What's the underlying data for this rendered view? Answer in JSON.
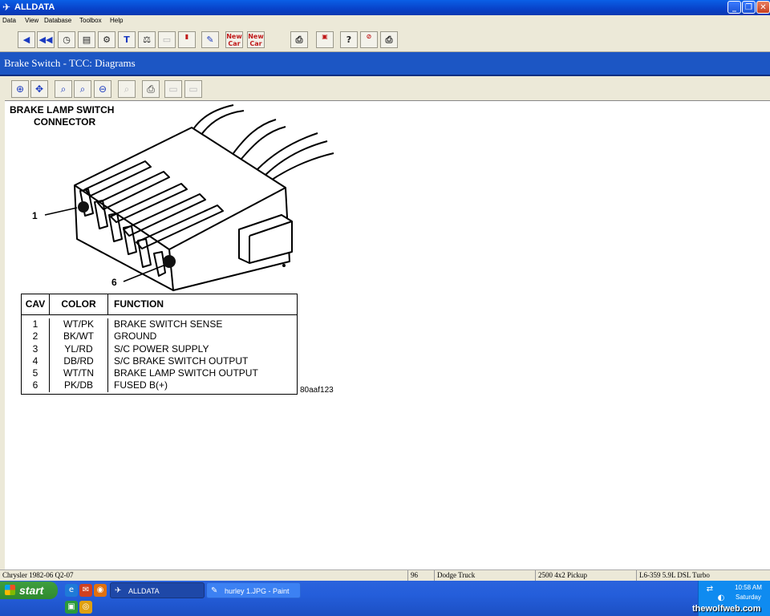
{
  "window": {
    "title": "ALLDATA",
    "controls": [
      "minimize",
      "restore",
      "close"
    ]
  },
  "menu": [
    "Data",
    "View",
    "Database",
    "Toolbox",
    "Help"
  ],
  "toolbar": {
    "new_car_label": "New Car",
    "new_car2_label": "New Car"
  },
  "document": {
    "header": "Brake Switch - TCC:  Diagrams"
  },
  "diagram": {
    "title_line1": "BRAKE LAMP SWITCH",
    "title_line2": "CONNECTOR",
    "callout_1": "1",
    "callout_6": "6",
    "ref_code": "80aaf123",
    "table": {
      "headers": [
        "CAV",
        "COLOR",
        "FUNCTION"
      ],
      "rows": [
        [
          "1",
          "WT/PK",
          "BRAKE SWITCH SENSE"
        ],
        [
          "2",
          "BK/WT",
          "GROUND"
        ],
        [
          "3",
          "YL/RD",
          "S/C POWER SUPPLY"
        ],
        [
          "4",
          "DB/RD",
          "S/C BRAKE SWITCH OUTPUT"
        ],
        [
          "5",
          "WT/TN",
          "BRAKE LAMP SWITCH OUTPUT"
        ],
        [
          "6",
          "PK/DB",
          "FUSED B(+)"
        ]
      ]
    }
  },
  "status": {
    "make": "Chrysler 1982-06 Q2-07",
    "year": "96",
    "model": "Dodge Truck",
    "body": "2500 4x2 Pickup",
    "engine": "L6-359 5.9L DSL Turbo"
  },
  "taskbar": {
    "start_label": "start",
    "tasks": [
      {
        "label": "ALLDATA"
      },
      {
        "label": "hurley 1.JPG - Paint"
      }
    ],
    "clock_time": "10:58 AM",
    "clock_day": "Saturday",
    "watermark": "thewolfweb.com"
  }
}
